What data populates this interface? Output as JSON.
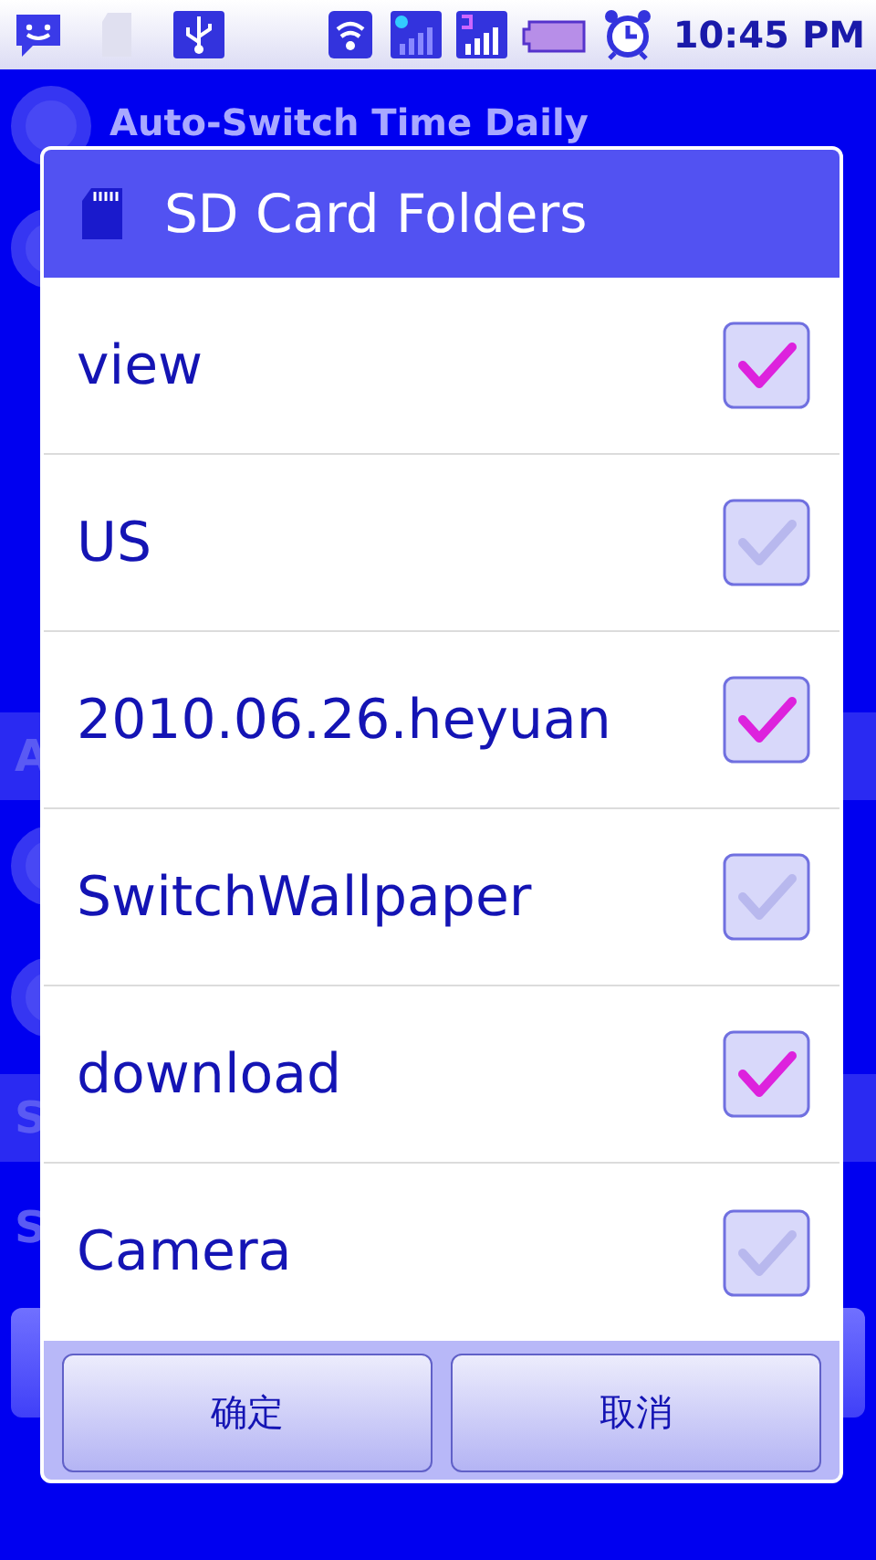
{
  "status_bar": {
    "time": "10:45 PM"
  },
  "background": {
    "rows": [
      {
        "kind": "radio",
        "label": "Auto-Switch Time Daily",
        "selected": false
      },
      {
        "kind": "radio",
        "selected": false
      },
      {
        "kind": "header",
        "label": "A"
      },
      {
        "kind": "radio",
        "selected": false
      },
      {
        "kind": "radio",
        "selected": false
      },
      {
        "kind": "header",
        "label": "S"
      },
      {
        "kind": "item",
        "label": "S"
      }
    ]
  },
  "dialog": {
    "title": "SD Card Folders",
    "items": [
      {
        "label": "view",
        "checked": true
      },
      {
        "label": "US",
        "checked": false
      },
      {
        "label": "2010.06.26.heyuan",
        "checked": true
      },
      {
        "label": "SwitchWallpaper",
        "checked": false
      },
      {
        "label": "download",
        "checked": true
      },
      {
        "label": "Camera",
        "checked": false
      }
    ],
    "buttons": [
      "确定",
      "取消"
    ]
  }
}
